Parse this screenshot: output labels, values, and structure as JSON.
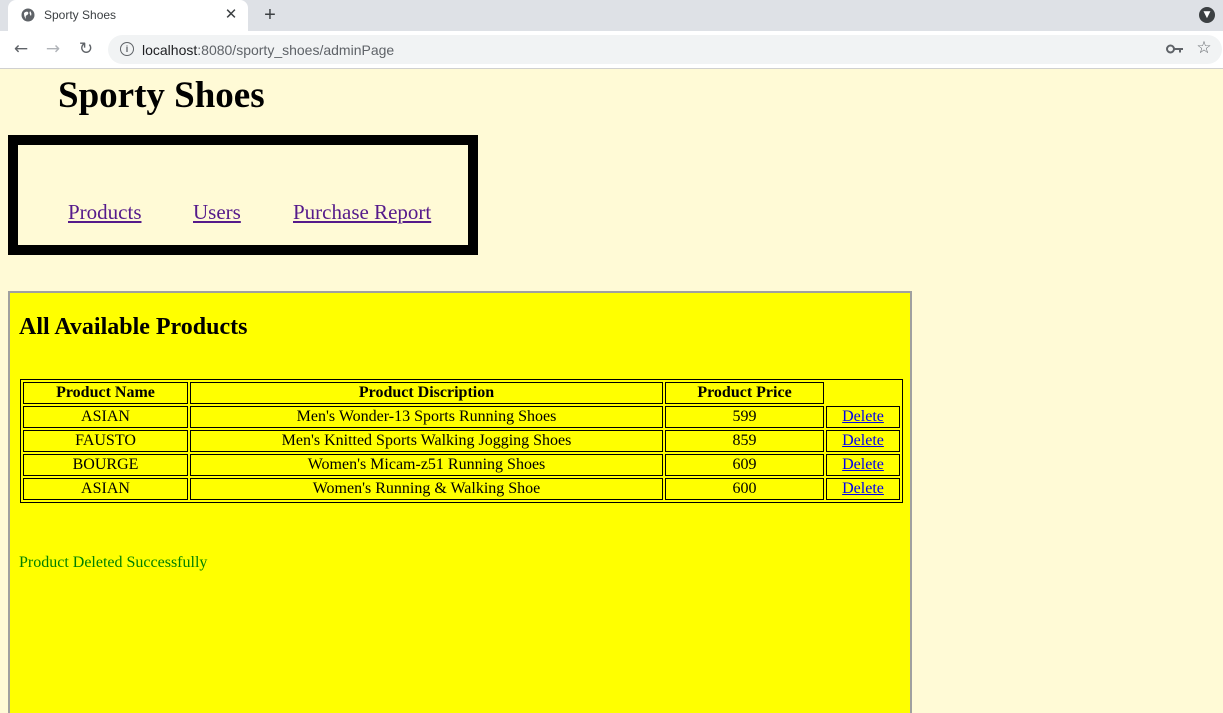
{
  "browser": {
    "tab_title": "Sporty Shoes",
    "url_host": "localhost",
    "url_rest": ":8080/sporty_shoes/adminPage"
  },
  "site": {
    "title": "Sporty Shoes"
  },
  "nav": {
    "products": "Products",
    "users": "Users",
    "purchase_report": "Purchase Report"
  },
  "products_panel": {
    "title": "All Available Products",
    "headers": {
      "name": "Product Name",
      "description": "Product Discription",
      "price": "Product Price"
    },
    "rows": [
      {
        "name": "ASIAN",
        "description": "Men's Wonder-13 Sports Running Shoes",
        "price": "599",
        "action": "Delete"
      },
      {
        "name": "FAUSTO",
        "description": "Men's Knitted Sports Walking Jogging Shoes",
        "price": "859",
        "action": "Delete"
      },
      {
        "name": "BOURGE",
        "description": "Women's Micam-z51 Running Shoes",
        "price": "609",
        "action": "Delete"
      },
      {
        "name": "ASIAN",
        "description": "Women's Running & Walking Shoe",
        "price": "600",
        "action": "Delete"
      }
    ],
    "status_message": "Product Deleted Successfully"
  },
  "colors": {
    "page_background": "#fffad6",
    "panel_background": "#ffff00",
    "status_text": "#008000",
    "visited_link": "#551a8b",
    "link": "#0000ee"
  }
}
